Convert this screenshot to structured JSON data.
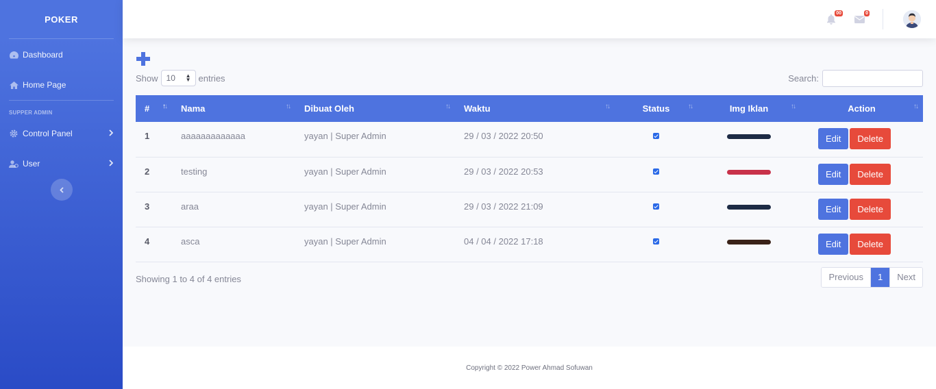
{
  "brand": "POKER",
  "sidebar": {
    "items": [
      {
        "label": "Dashboard",
        "icon": "dashboard-icon"
      },
      {
        "label": "Home Page",
        "icon": "home-icon"
      }
    ],
    "heading": "SUPPER ADMIN",
    "collapsible": [
      {
        "label": "Control Panel",
        "icon": "gear-icon"
      },
      {
        "label": "User",
        "icon": "user-icon"
      }
    ]
  },
  "topbar": {
    "alerts_badge": "00",
    "messages_badge": "0"
  },
  "controls": {
    "show_label": "Show",
    "entries_value": "10",
    "entries_label": "entries",
    "search_label": "Search:",
    "search_value": ""
  },
  "table": {
    "headers": [
      "#",
      "Nama",
      "Dibuat Oleh",
      "Waktu",
      "Status",
      "Img Iklan",
      "Action"
    ],
    "rows": [
      {
        "id": "1",
        "nama": "aaaaaaaaaaaaa",
        "dibuat_oleh": "yayan | Super Admin",
        "waktu": "29 / 03 / 2022 20:50",
        "status": true,
        "img_color": "#1d2b45"
      },
      {
        "id": "2",
        "nama": "testing",
        "dibuat_oleh": "yayan | Super Admin",
        "waktu": "29 / 03 / 2022 20:53",
        "status": true,
        "img_color": "#c8324a"
      },
      {
        "id": "3",
        "nama": "araa",
        "dibuat_oleh": "yayan | Super Admin",
        "waktu": "29 / 03 / 2022 21:09",
        "status": true,
        "img_color": "#1d2b45"
      },
      {
        "id": "4",
        "nama": "asca",
        "dibuat_oleh": "yayan | Super Admin",
        "waktu": "04 / 04 / 2022 17:18",
        "status": true,
        "img_color": "#3a2218"
      }
    ],
    "edit_label": "Edit",
    "delete_label": "Delete"
  },
  "info": "Showing 1 to 4 of 4 entries",
  "pagination": {
    "previous": "Previous",
    "current": "1",
    "next": "Next"
  },
  "footer": "Copyright © 2022 Power Ahmad Sofuwan",
  "colors": {
    "primary": "#4e73df",
    "danger": "#e74a3b"
  }
}
